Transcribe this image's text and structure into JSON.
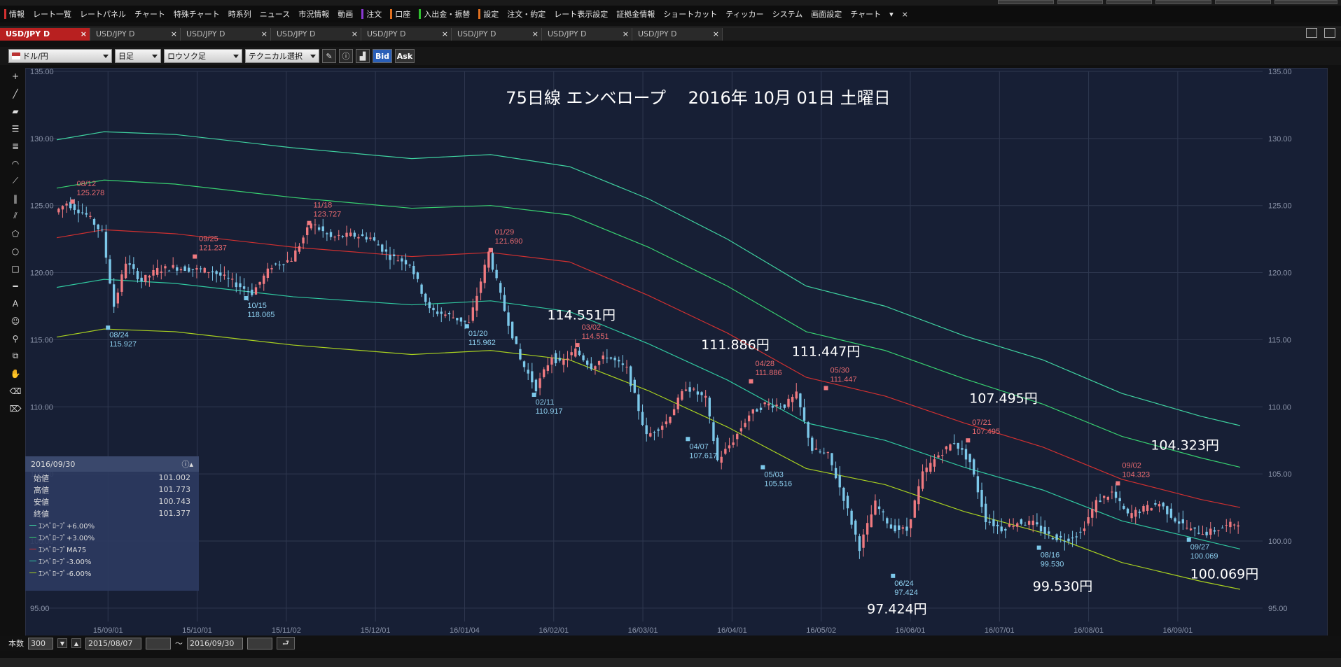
{
  "menu": {
    "items": [
      {
        "label": "情報",
        "accent": "#d23030"
      },
      {
        "label": "レート一覧"
      },
      {
        "label": "レートパネル"
      },
      {
        "label": "チャート"
      },
      {
        "label": "特殊チャート"
      },
      {
        "label": "時系列"
      },
      {
        "label": "ニュース"
      },
      {
        "label": "市況情報"
      },
      {
        "label": "動画"
      },
      {
        "label": "注文",
        "accent": "#8a3ad2"
      },
      {
        "label": "口座",
        "accent": "#e07020"
      },
      {
        "label": "入出金・振替",
        "accent": "#30c030"
      },
      {
        "label": "設定",
        "accent": "#e07020"
      },
      {
        "label": "注文・約定"
      },
      {
        "label": "レート表示設定"
      },
      {
        "label": "証拠金情報"
      },
      {
        "label": "ショートカット"
      },
      {
        "label": "ティッカー"
      },
      {
        "label": "システム"
      },
      {
        "label": "画面設定"
      },
      {
        "label": "チャート"
      }
    ],
    "overflow_icon": "▾",
    "close_icon": "×"
  },
  "tabs": [
    {
      "label": "USD/JPY D",
      "active": true
    },
    {
      "label": "USD/JPY D"
    },
    {
      "label": "USD/JPY D"
    },
    {
      "label": "USD/JPY D"
    },
    {
      "label": "USD/JPY D"
    },
    {
      "label": "USD/JPY D"
    },
    {
      "label": "USD/JPY D"
    },
    {
      "label": "USD/JPY D"
    }
  ],
  "tab_close": "×",
  "toolbar": {
    "pair": "ドル/円",
    "period": "日足",
    "chart_type": "ロウソク足",
    "technical": "テクニカル選択",
    "bid": "Bid",
    "ask": "Ask"
  },
  "info_panel": {
    "date": "2016/09/30",
    "rows": [
      {
        "label": "始値",
        "value": "101.002"
      },
      {
        "label": "高値",
        "value": "101.773"
      },
      {
        "label": "安値",
        "value": "100.743"
      },
      {
        "label": "終値",
        "value": "101.377"
      }
    ],
    "legend": [
      {
        "label": "ｴﾝﾍﾞﾛｰﾌﾟ+6.00%",
        "color": "#3fd2a0"
      },
      {
        "label": "ｴﾝﾍﾞﾛｰﾌﾟ+3.00%",
        "color": "#38d070"
      },
      {
        "label": "ｴﾝﾍﾞﾛｰﾌﾟMA75",
        "color": "#d03030"
      },
      {
        "label": "ｴﾝﾍﾞﾛｰﾌﾟ-3.00%",
        "color": "#30c8a0"
      },
      {
        "label": "ｴﾝﾍﾞﾛｰﾌﾟ-6.00%",
        "color": "#a8d020"
      }
    ]
  },
  "bottom": {
    "count_label": "本数",
    "count_value": "300",
    "from": "2015/08/07",
    "tilde": "～",
    "to": "2016/09/30"
  },
  "chart_data": {
    "type": "candlestick",
    "title": "75日線 エンベロープ　 2016年 10月 01日 土曜日",
    "ylim": [
      94,
      135
    ],
    "y_ticks": [
      95,
      100,
      105,
      110,
      115,
      120,
      125,
      130,
      135
    ],
    "y_tick_labels": [
      "95.00",
      "100.00",
      "105.00",
      "110.00",
      "115.00",
      "120.00",
      "125.00",
      "130.00",
      "135.00"
    ],
    "x_ticks": [
      "15/09/01",
      "15/10/01",
      "15/11/02",
      "15/12/01",
      "16/01/04",
      "16/02/01",
      "16/03/01",
      "16/04/01",
      "16/05/02",
      "16/06/01",
      "16/07/01",
      "16/08/01",
      "16/09/01"
    ],
    "colors": {
      "up": "#f07a80",
      "down": "#7cc8ea",
      "grid": "#2f3850",
      "axis_text": "#8a93a8"
    },
    "series": [
      {
        "name": "ｴﾝﾍﾞﾛｰﾌﾟ+6.00%",
        "color": "#3fd2a0",
        "x": [
          0,
          12,
          30,
          60,
          90,
          110,
          130,
          150,
          170,
          190,
          210,
          230,
          250,
          270,
          290,
          300
        ],
        "y": [
          129.9,
          130.5,
          130.3,
          129.3,
          128.5,
          128.8,
          127.9,
          125.5,
          122.5,
          119.0,
          117.5,
          115.3,
          113.5,
          111.0,
          109.3,
          108.6
        ]
      },
      {
        "name": "ｴﾝﾍﾞﾛｰﾌﾟ+3.00%",
        "color": "#38d070",
        "x": [
          0,
          12,
          30,
          60,
          90,
          110,
          130,
          150,
          170,
          190,
          210,
          230,
          250,
          270,
          290,
          300
        ],
        "y": [
          126.3,
          126.9,
          126.6,
          125.6,
          124.8,
          125.0,
          124.3,
          121.9,
          119.0,
          115.6,
          114.2,
          112.1,
          110.2,
          107.8,
          106.2,
          105.5
        ]
      },
      {
        "name": "ｴﾝﾍﾞﾛｰﾌﾟMA75",
        "color": "#d03030",
        "x": [
          0,
          12,
          30,
          60,
          90,
          110,
          130,
          150,
          170,
          190,
          210,
          230,
          250,
          270,
          290,
          300
        ],
        "y": [
          122.6,
          123.2,
          122.9,
          121.9,
          121.2,
          121.5,
          120.8,
          118.3,
          115.5,
          112.2,
          110.8,
          108.8,
          107.0,
          104.6,
          103.1,
          102.5
        ]
      },
      {
        "name": "ｴﾝﾍﾞﾛｰﾌﾟ-3.00%",
        "color": "#30c8a0",
        "x": [
          0,
          12,
          30,
          60,
          90,
          110,
          130,
          150,
          170,
          190,
          210,
          230,
          250,
          270,
          290,
          300
        ],
        "y": [
          118.9,
          119.5,
          119.2,
          118.2,
          117.6,
          117.9,
          117.1,
          114.7,
          112.0,
          108.8,
          107.5,
          105.5,
          103.8,
          101.5,
          100.1,
          99.4
        ]
      },
      {
        "name": "ｴﾝﾍﾞﾛｰﾌﾟ-6.00%",
        "color": "#a8d020",
        "x": [
          0,
          12,
          30,
          60,
          90,
          110,
          130,
          150,
          170,
          190,
          210,
          230,
          250,
          270,
          290,
          300
        ],
        "y": [
          115.2,
          115.8,
          115.6,
          114.6,
          113.9,
          114.2,
          113.5,
          111.2,
          108.5,
          105.4,
          104.2,
          102.2,
          100.6,
          98.4,
          97.0,
          96.4
        ]
      }
    ],
    "price_path": {
      "x": [
        0,
        3,
        8,
        12,
        15,
        18,
        22,
        26,
        30,
        40,
        50,
        55,
        60,
        65,
        70,
        75,
        80,
        85,
        90,
        95,
        100,
        105,
        110,
        114,
        118,
        122,
        126,
        128,
        132,
        136,
        140,
        145,
        150,
        155,
        160,
        165,
        168,
        172,
        176,
        180,
        185,
        188,
        192,
        196,
        200,
        204,
        208,
        212,
        216,
        220,
        224,
        228,
        232,
        236,
        240,
        244,
        248,
        252,
        256,
        260,
        264,
        268,
        272,
        276,
        280,
        284,
        288,
        292,
        296,
        300
      ],
      "y": [
        124.5,
        125.2,
        124.3,
        123.0,
        117.5,
        120.8,
        119.4,
        120.2,
        120.4,
        120.1,
        118.5,
        120.5,
        121.0,
        123.7,
        122.6,
        122.8,
        122.6,
        121.2,
        120.7,
        117.2,
        116.8,
        116.2,
        121.5,
        117.2,
        113.5,
        111.4,
        113.8,
        113.2,
        114.2,
        113.0,
        113.8,
        112.8,
        107.8,
        108.9,
        111.5,
        110.6,
        106.0,
        107.5,
        109.4,
        110.2,
        110.1,
        110.9,
        106.8,
        106.4,
        103.2,
        99.5,
        102.8,
        101.0,
        100.8,
        105.0,
        106.4,
        107.4,
        105.9,
        101.6,
        100.9,
        101.4,
        101.3,
        100.4,
        100.1,
        100.6,
        102.9,
        103.6,
        101.9,
        102.4,
        102.8,
        101.6,
        100.8,
        100.6,
        101.0,
        101.4
      ]
    },
    "labels_high": [
      {
        "date": "08/12",
        "value": "125.278",
        "x": 4,
        "y": 125.3
      },
      {
        "date": "09/25",
        "value": "121.237",
        "x": 35,
        "y": 121.2
      },
      {
        "date": "11/18",
        "value": "123.727",
        "x": 64,
        "y": 123.7
      },
      {
        "date": "01/29",
        "value": "121.690",
        "x": 110,
        "y": 121.7
      },
      {
        "date": "03/02",
        "value": "114.551",
        "x": 132,
        "y": 114.6
      },
      {
        "date": "04/28",
        "value": "111.886",
        "x": 176,
        "y": 111.9
      },
      {
        "date": "05/30",
        "value": "111.447",
        "x": 195,
        "y": 111.4
      },
      {
        "date": "07/21",
        "value": "107.495",
        "x": 231,
        "y": 107.5
      },
      {
        "date": "09/02",
        "value": "104.323",
        "x": 269,
        "y": 104.3
      }
    ],
    "labels_low": [
      {
        "date": "08/24",
        "value": "115.927",
        "x": 13,
        "y": 115.9
      },
      {
        "date": "10/15",
        "value": "118.065",
        "x": 48,
        "y": 118.1
      },
      {
        "date": "01/20",
        "value": "115.962",
        "x": 104,
        "y": 116.0
      },
      {
        "date": "02/11",
        "value": "110.917",
        "x": 121,
        "y": 110.9
      },
      {
        "date": "04/07",
        "value": "107.617",
        "x": 160,
        "y": 107.6
      },
      {
        "date": "05/03",
        "value": "105.516",
        "x": 179,
        "y": 105.5
      },
      {
        "date": "06/24",
        "value": "97.424",
        "x": 212,
        "y": 97.4
      },
      {
        "date": "08/16",
        "value": "99.530",
        "x": 249,
        "y": 99.5
      },
      {
        "date": "09/27",
        "value": "100.069",
        "x": 287,
        "y": 100.1
      }
    ],
    "annotations": [
      {
        "text": "114.551円",
        "x": 133,
        "y": 116.5
      },
      {
        "text": "111.886円",
        "x": 172,
        "y": 114.3
      },
      {
        "text": "111.447円",
        "x": 195,
        "y": 113.8
      },
      {
        "text": "107.495円",
        "x": 240,
        "y": 110.3
      },
      {
        "text": "104.323円",
        "x": 286,
        "y": 106.8
      },
      {
        "text": "97.424円",
        "x": 213,
        "y": 94.6
      },
      {
        "text": "99.530円",
        "x": 255,
        "y": 96.3
      },
      {
        "text": "100.069円",
        "x": 296,
        "y": 97.2
      }
    ]
  }
}
